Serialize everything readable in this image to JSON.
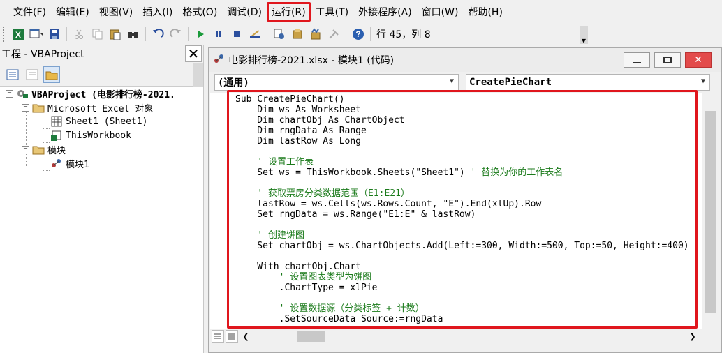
{
  "menu": {
    "items": [
      "文件(F)",
      "编辑(E)",
      "视图(V)",
      "插入(I)",
      "格式(O)",
      "调试(D)",
      "运行(R)",
      "工具(T)",
      "外接程序(A)",
      "窗口(W)",
      "帮助(H)"
    ],
    "highlighted_index": 6
  },
  "toolbar": {
    "position_label": "行 45，列 8"
  },
  "project_panel": {
    "title": "工程 - VBAProject",
    "tree": {
      "root": "VBAProject (电影排行榜-2021.",
      "excel_objects_folder": "Microsoft Excel 对象",
      "sheet1": "Sheet1 (Sheet1)",
      "this_workbook": "ThisWorkbook",
      "modules_folder": "模块",
      "module1": "模块1"
    }
  },
  "code_window": {
    "title": "电影排行榜-2021.xlsx - 模块1 (代码)",
    "object_combo": "(通用)",
    "procedure_combo": "CreatePieChart",
    "code_lines": [
      {
        "text": "Sub CreatePieChart()",
        "type": "code"
      },
      {
        "text": "    Dim ws As Worksheet",
        "type": "code"
      },
      {
        "text": "    Dim chartObj As ChartObject",
        "type": "code"
      },
      {
        "text": "    Dim rngData As Range",
        "type": "code"
      },
      {
        "text": "    Dim lastRow As Long",
        "type": "code"
      },
      {
        "text": "",
        "type": "code"
      },
      {
        "text": "    ' 设置工作表",
        "type": "comment"
      },
      {
        "text": "    Set ws = ThisWorkbook.Sheets(\"Sheet1\") ",
        "type": "code",
        "comment": "' 替换为你的工作表名"
      },
      {
        "text": "",
        "type": "code"
      },
      {
        "text": "    ' 获取票房分类数据范围（E1:E21）",
        "type": "comment"
      },
      {
        "text": "    lastRow = ws.Cells(ws.Rows.Count, \"E\").End(xlUp).Row",
        "type": "code"
      },
      {
        "text": "    Set rngData = ws.Range(\"E1:E\" & lastRow)",
        "type": "code"
      },
      {
        "text": "",
        "type": "code"
      },
      {
        "text": "    ' 创建饼图",
        "type": "comment"
      },
      {
        "text": "    Set chartObj = ws.ChartObjects.Add(Left:=300, Width:=500, Top:=50, Height:=400)",
        "type": "code"
      },
      {
        "text": "",
        "type": "code"
      },
      {
        "text": "    With chartObj.Chart",
        "type": "code"
      },
      {
        "text": "        ' 设置图表类型为饼图",
        "type": "comment"
      },
      {
        "text": "        .ChartType = xlPie",
        "type": "code"
      },
      {
        "text": "",
        "type": "code"
      },
      {
        "text": "        ' 设置数据源（分类标签 + 计数）",
        "type": "comment"
      },
      {
        "text": "        .SetSourceData Source:=rngData",
        "type": "code"
      }
    ]
  },
  "colors": {
    "highlight": "#e0161d",
    "comment": "#1a7a1a",
    "keyword": "#00008b"
  }
}
